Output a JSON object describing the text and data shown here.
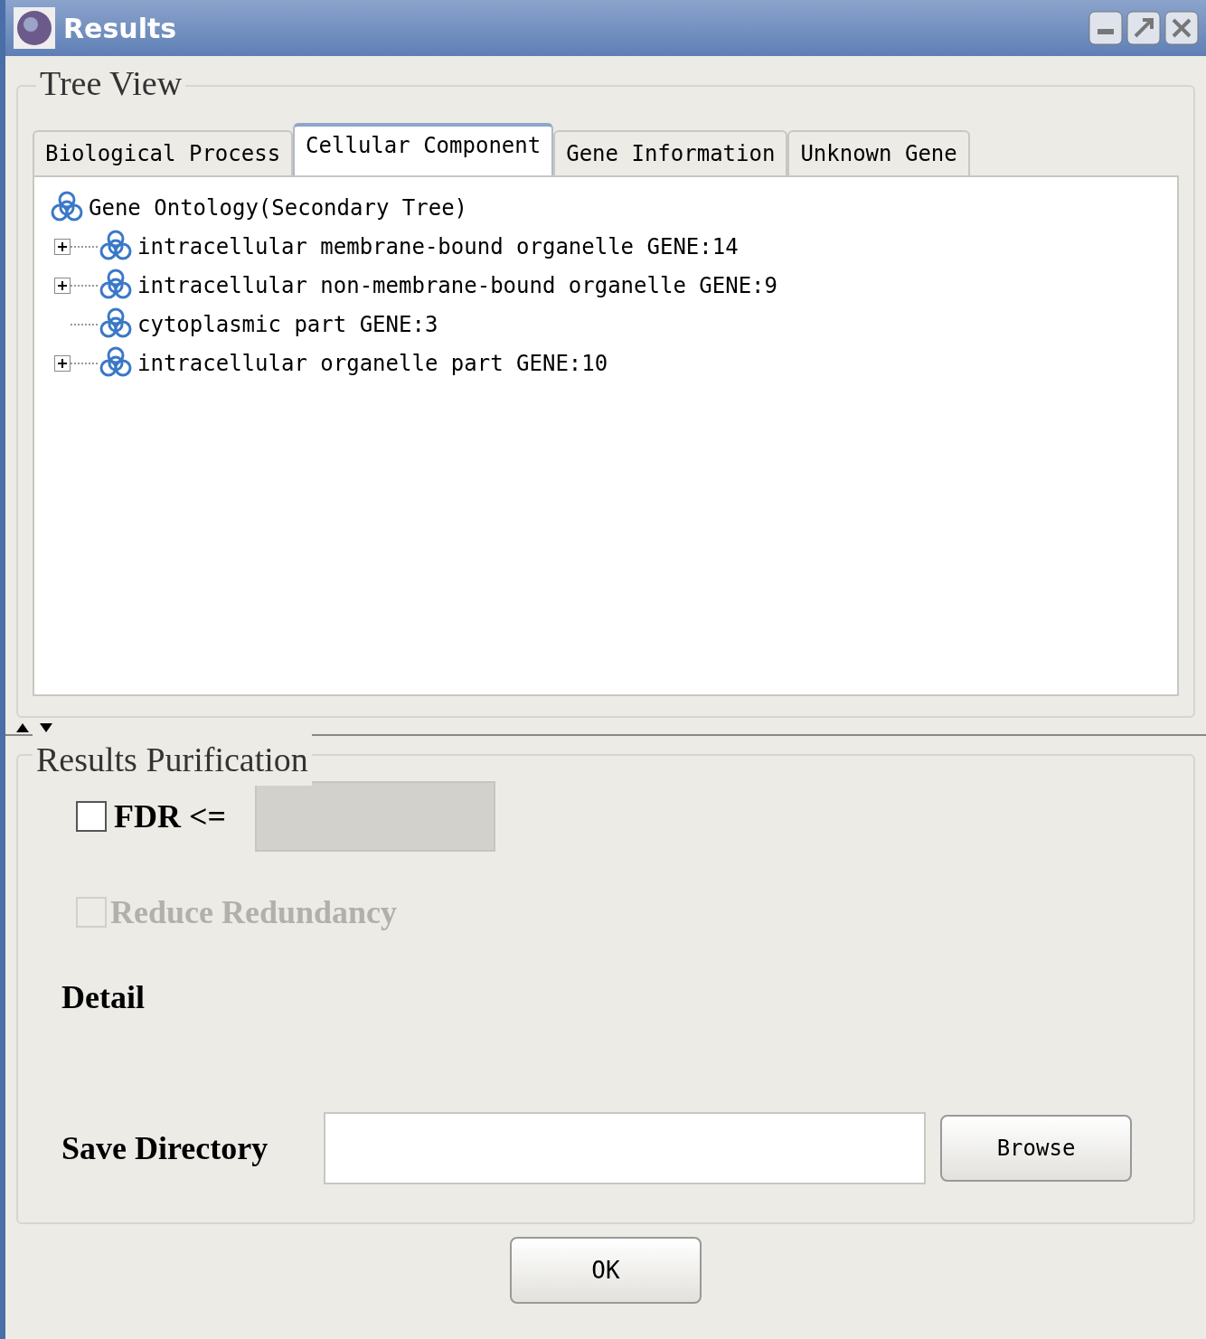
{
  "window": {
    "title": "Results"
  },
  "tree_view": {
    "title": "Tree View",
    "tabs": [
      {
        "label": "Biological Process",
        "selected": false
      },
      {
        "label": "Cellular Component",
        "selected": true
      },
      {
        "label": "Gene Information",
        "selected": false
      },
      {
        "label": "Unknown Gene",
        "selected": false
      }
    ],
    "tree": {
      "label": "Gene Ontology(Secondary Tree)",
      "children": [
        {
          "label": "intracellular membrane-bound organelle GENE:14",
          "kind": "branch",
          "expanded": false
        },
        {
          "label": "intracellular non-membrane-bound organelle GENE:9",
          "kind": "branch",
          "expanded": false
        },
        {
          "label": "cytoplasmic part GENE:3",
          "kind": "leaf"
        },
        {
          "label": "intracellular organelle part GENE:10",
          "kind": "branch",
          "expanded": false
        }
      ]
    }
  },
  "purification": {
    "title": "Results Purification",
    "fdr": {
      "label": "FDR <=",
      "checked": false,
      "disabled": false,
      "field_disabled": true
    },
    "reduce_redundancy": {
      "label": "Reduce Redundancy",
      "checked": false,
      "disabled": true
    },
    "detail_label": "Detail",
    "save_directory": {
      "label": "Save Directory",
      "button": "Browse"
    }
  },
  "ok_button": "OK"
}
